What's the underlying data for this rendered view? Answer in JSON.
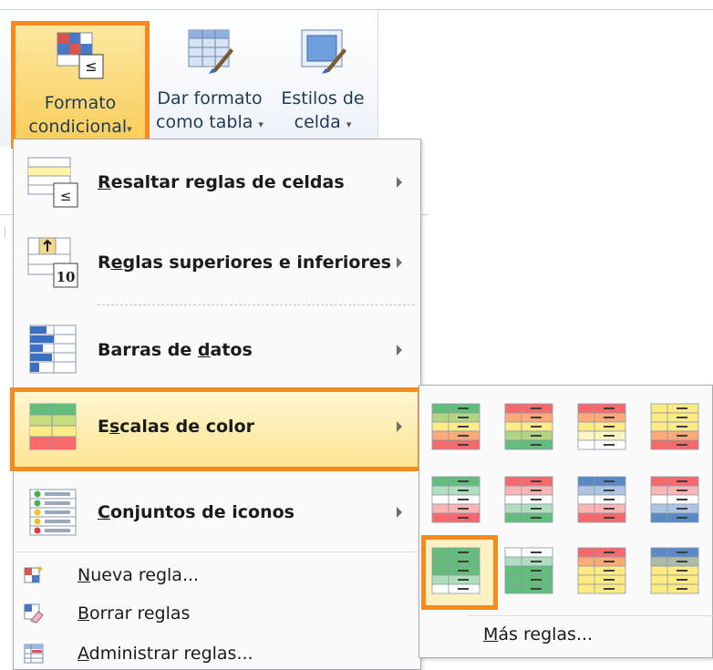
{
  "ribbon": {
    "formato_line1": "Formato",
    "formato_line2": "condicional",
    "tabla_line1": "Dar formato",
    "tabla_line2": "como tabla",
    "estilos_line1": "Estilos de",
    "estilos_line2": "celda",
    "caret": "▾"
  },
  "menu": {
    "items": [
      {
        "icon": "highlight-rules-icon",
        "pre": "",
        "key": "R",
        "post": "esaltar reglas de celdas"
      },
      {
        "icon": "top-bottom-rules-icon",
        "pre": "R",
        "key": "e",
        "post": "glas superiores e inferiores"
      },
      {
        "icon": "data-bars-icon",
        "pre": "Barras de ",
        "key": "d",
        "post": "atos"
      },
      {
        "icon": "color-scales-icon",
        "pre": "E",
        "key": "s",
        "post": "calas de color"
      },
      {
        "icon": "icon-sets-icon",
        "pre": "",
        "key": "C",
        "post": "onjuntos de iconos"
      }
    ],
    "small_items": [
      {
        "icon": "new-rule-icon",
        "pre": "",
        "key": "N",
        "post": "ueva regla..."
      },
      {
        "icon": "clear-rules-icon",
        "pre": "",
        "key": "B",
        "post": "orrar reglas"
      },
      {
        "icon": "manage-rules-icon",
        "pre": "",
        "key": "A",
        "post": "dministrar reglas..."
      }
    ]
  },
  "submenu": {
    "more_pre": "",
    "more_key": "M",
    "more_post": "ás reglas...",
    "scales": [
      [
        "#63be7b",
        "#ffeb84",
        "#f8696b"
      ],
      [
        "#f8696b",
        "#ffeb84",
        "#63be7b"
      ],
      [
        "#f8696b",
        "#ffeb84",
        "#ffffff"
      ],
      [
        "#ffeb84",
        "#ffeb84",
        "#f8696b"
      ],
      [
        "#63be7b",
        "#ffffff",
        "#f8696b"
      ],
      [
        "#f8696b",
        "#ffffff",
        "#63be7b"
      ],
      [
        "#5a8ac6",
        "#ffffff",
        "#f8696b"
      ],
      [
        "#f8696b",
        "#ffffff",
        "#5a8ac6"
      ],
      [
        "#63be7b",
        "#63be7b",
        "#ffffff"
      ],
      [
        "#ffffff",
        "#63be7b",
        "#63be7b"
      ],
      [
        "#f8696b",
        "#ffeb84",
        "#ffeb84"
      ],
      [
        "#5a8ac6",
        "#ffeb84",
        "#ffeb84"
      ]
    ]
  },
  "colors": {
    "highlight_orange": "#f68a1e",
    "ribbon_text": "#1e395b"
  }
}
